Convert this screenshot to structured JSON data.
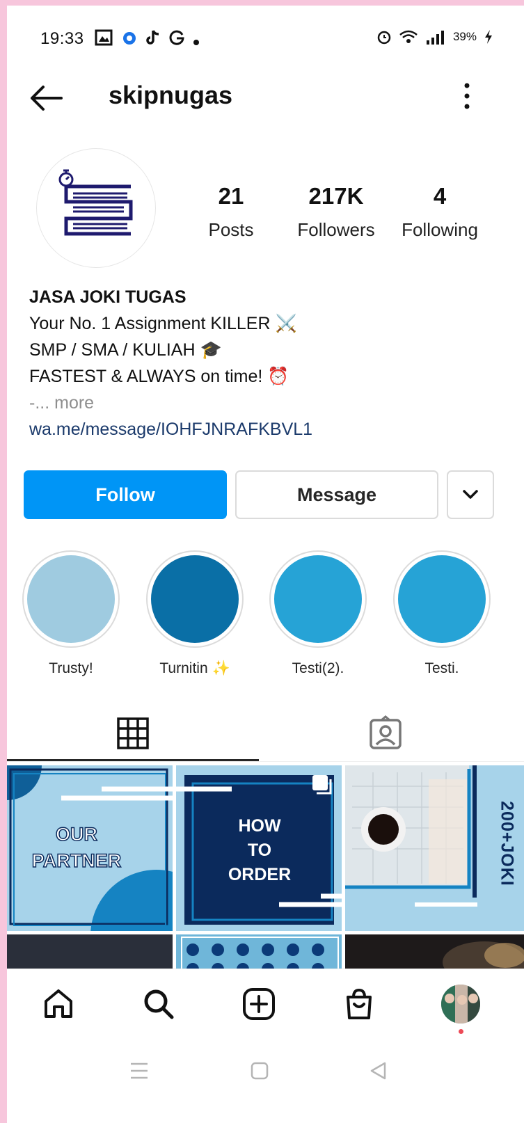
{
  "status_bar": {
    "time": "19:33",
    "battery": "39%"
  },
  "header": {
    "username": "skipnugas"
  },
  "profile": {
    "stats": [
      {
        "value": "21",
        "label": "Posts"
      },
      {
        "value": "217K",
        "label": "Followers"
      },
      {
        "value": "4",
        "label": "Following"
      }
    ],
    "bio": {
      "name": "JASA JOKI TUGAS",
      "line1": "Your No. 1 Assignment KILLER ⚔️",
      "line2": "SMP / SMA / KULIAH 🎓",
      "line3": "FASTEST & ALWAYS on time! ⏰",
      "more_prefix": "-...",
      "more": "more",
      "link": "wa.me/message/IOHFJNRAFKBVL1"
    }
  },
  "actions": {
    "follow": "Follow",
    "message": "Message"
  },
  "highlights": [
    {
      "label": "Trusty!",
      "color": "#9fcbe0"
    },
    {
      "label": "Turnitin ✨",
      "color": "#0a6fa6"
    },
    {
      "label": "Testi(2).",
      "color": "#26a3d6"
    },
    {
      "label": "Testi.",
      "color": "#26a3d6"
    }
  ],
  "tiles": {
    "our_partner": [
      "OUR",
      "PARTNER"
    ],
    "how_to_order": [
      "HOW",
      "TO",
      "ORDER"
    ],
    "joki": "200+JOKI"
  },
  "colors": {
    "accent": "#0095f6",
    "link": "#1b3a6b",
    "navy": "#0b2a5c"
  }
}
